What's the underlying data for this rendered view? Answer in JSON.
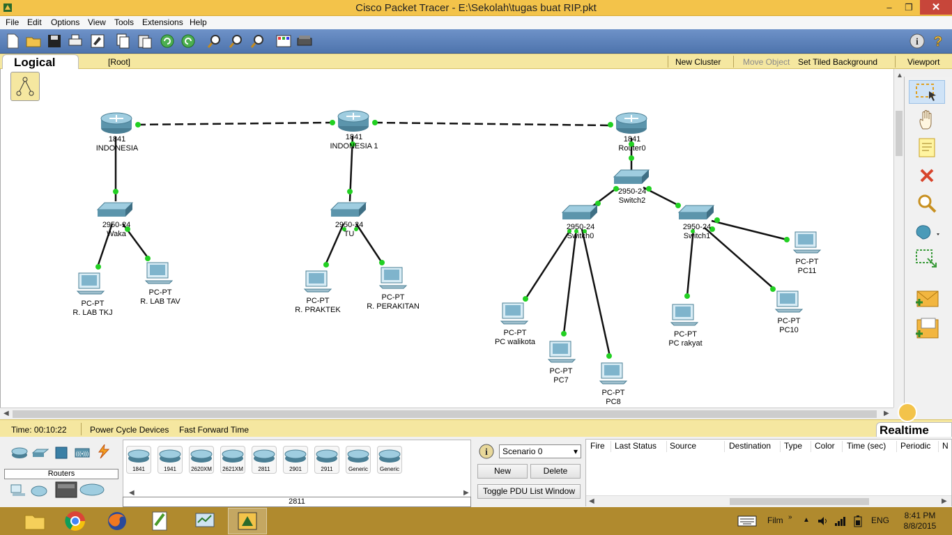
{
  "window": {
    "title": "Cisco Packet Tracer - E:\\Sekolah\\tugas buat RIP.pkt",
    "minimize": "–",
    "restore": "❐",
    "close": "✕"
  },
  "menu": [
    "File",
    "Edit",
    "Options",
    "View",
    "Tools",
    "Extensions",
    "Help"
  ],
  "toolbar": {
    "left_icons": [
      "new-file-icon",
      "open-folder-icon",
      "save-icon",
      "print-icon",
      "activity-wizard-icon",
      "copy-icon",
      "paste-icon",
      "undo-icon",
      "redo-icon",
      "zoom-in-icon",
      "zoom-reset-icon",
      "zoom-out-icon",
      "palette-icon",
      "custom-device-icon"
    ],
    "right_icons": [
      "info-icon",
      "help-icon"
    ]
  },
  "logical_bar": {
    "tab": "Logical",
    "root": "[Root]",
    "new_cluster": "New Cluster",
    "move_object": "Move Object",
    "set_tiled_background": "Set Tiled Background",
    "viewport": "Viewport"
  },
  "topology": {
    "routers": [
      {
        "model": "1841",
        "name": "INDONESIA"
      },
      {
        "model": "1841",
        "name": "INDONESIA 1"
      },
      {
        "model": "1841",
        "name": "Router0"
      }
    ],
    "switches": [
      {
        "model": "2950-24",
        "name": "Waka"
      },
      {
        "model": "2950-24",
        "name": "TU"
      },
      {
        "model": "2950-24",
        "name": "Switch2"
      },
      {
        "model": "2950-24",
        "name": "Switch0"
      },
      {
        "model": "2950-24",
        "name": "Switch1"
      }
    ],
    "pcs": [
      {
        "model": "PC-PT",
        "name": "R. LAB TKJ"
      },
      {
        "model": "PC-PT",
        "name": "R. LAB TAV"
      },
      {
        "model": "PC-PT",
        "name": "R. PRAKTEK"
      },
      {
        "model": "PC-PT",
        "name": "R. PERAKITAN"
      },
      {
        "model": "PC-PT",
        "name": "PC walikota"
      },
      {
        "model": "PC-PT",
        "name": "PC7"
      },
      {
        "model": "PC-PT",
        "name": "PC8"
      },
      {
        "model": "PC-PT",
        "name": "PC rakyat"
      },
      {
        "model": "PC-PT",
        "name": "PC10"
      },
      {
        "model": "PC-PT",
        "name": "PC11"
      }
    ]
  },
  "right_tools": [
    "select-icon",
    "move-hand-icon",
    "note-icon",
    "delete-icon",
    "inspect-icon",
    "draw-shape-icon",
    "resize-icon",
    "add-simple-pdu-icon",
    "add-complex-pdu-icon"
  ],
  "time_bar": {
    "time": "Time: 00:10:22",
    "power_cycle": "Power Cycle Devices",
    "fast_forward": "Fast Forward Time",
    "mode": "Realtime"
  },
  "device_panel": {
    "category": "Routers",
    "selected_model": "2811",
    "models": [
      "1841",
      "1941",
      "2620XM",
      "2621XM",
      "2811",
      "2901",
      "2911",
      "Generic",
      "Generic"
    ]
  },
  "scenario": {
    "selected": "Scenario 0",
    "new": "New",
    "delete": "Delete",
    "toggle": "Toggle PDU List Window"
  },
  "pdu_table": {
    "columns": [
      "Fire",
      "Last Status",
      "Source",
      "Destination",
      "Type",
      "Color",
      "Time (sec)",
      "Periodic",
      "N"
    ]
  },
  "taskbar": {
    "apps": [
      "file-explorer-icon",
      "chrome-icon",
      "firefox-icon",
      "notepad-plus-icon",
      "task-manager-icon",
      "packet-tracer-icon"
    ],
    "tray_label": "Film",
    "lang": "ENG",
    "time": "8:41 PM",
    "date": "8/8/2015"
  }
}
